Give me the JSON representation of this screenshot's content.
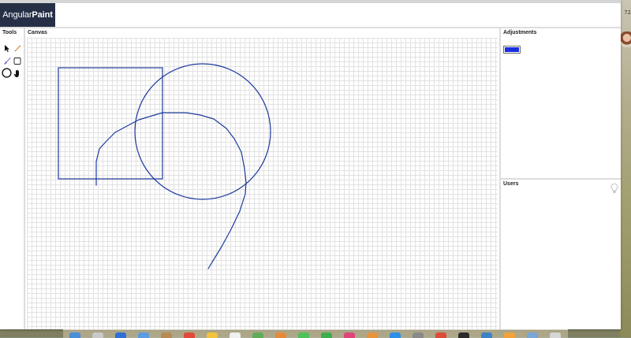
{
  "app": {
    "brand_prefix": "Angular",
    "brand_suffix": "Paint"
  },
  "panels": {
    "tools_title": "Tools",
    "canvas_title": "Canvas",
    "adjustments_title": "Adjustments",
    "users_title": "Users"
  },
  "tools": [
    {
      "name": "select-arrow-icon"
    },
    {
      "name": "pencil-icon"
    },
    {
      "name": "brush-icon"
    },
    {
      "name": "rectangle-icon"
    },
    {
      "name": "circle-icon"
    },
    {
      "name": "hand-icon"
    }
  ],
  "adjustments": {
    "current_color": "#1a2fe0"
  },
  "users": {
    "icon": "lightbulb-icon"
  },
  "colors": {
    "header_brand_bg": "#253047",
    "stroke": "#1c3a9e",
    "grid": "#e2e2e2"
  },
  "desktop": {
    "side_text": "72"
  },
  "dock": {
    "icons": [
      "finder-icon",
      "launchpad-icon",
      "safari-icon",
      "mail-icon",
      "contacts-icon",
      "calendar-icon",
      "notes-icon",
      "reminders-icon",
      "maps-icon",
      "photos-icon",
      "messages-icon",
      "facetime-icon",
      "itunes-icon",
      "ibooks-icon",
      "appstore-icon",
      "preferences-icon",
      "chrome-icon",
      "terminal-icon",
      "xcode-icon",
      "sketch-icon",
      "downloads-icon",
      "trash-icon"
    ]
  }
}
